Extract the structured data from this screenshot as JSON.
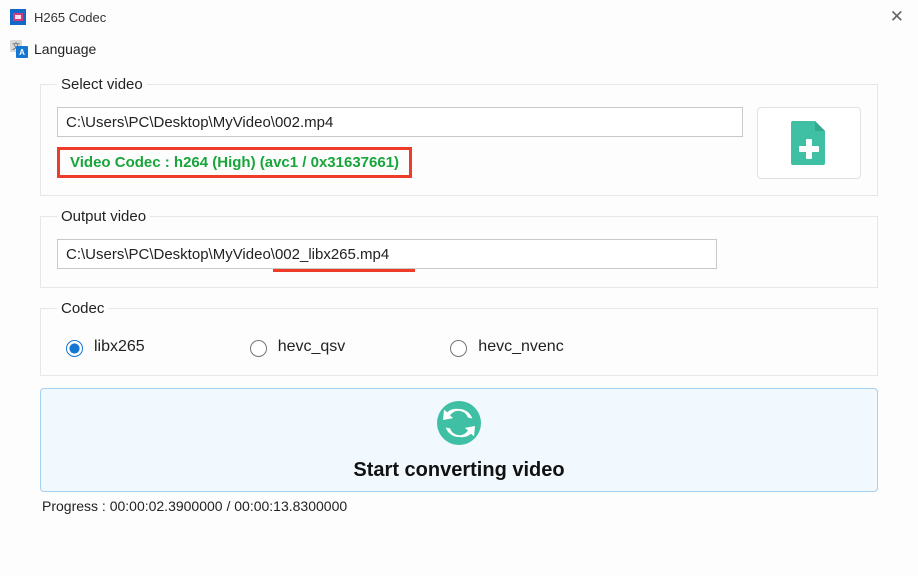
{
  "window": {
    "title": "H265 Codec",
    "close_glyph": "✕"
  },
  "menu": {
    "language_label": "Language"
  },
  "select_video": {
    "legend": "Select video",
    "input_path": "C:\\Users\\PC\\Desktop\\MyVideo\\002.mp4",
    "codec_info": "Video Codec : h264 (High) (avc1 / 0x31637661)"
  },
  "output_video": {
    "legend": "Output video",
    "output_path": "C:\\Users\\PC\\Desktop\\MyVideo\\002_libx265.mp4"
  },
  "codec": {
    "legend": "Codec",
    "selected": "libx265",
    "options": {
      "opt0": "libx265",
      "opt1": "hevc_qsv",
      "opt2": "hevc_nvenc"
    }
  },
  "convert": {
    "label": "Start converting video"
  },
  "progress": {
    "text": "Progress : 00:00:02.3900000 / 00:00:13.8300000"
  },
  "colors": {
    "accent_teal": "#3fbfa4",
    "highlight_red": "#ef3b2a",
    "codec_green": "#18a53a",
    "convert_bg": "#f1f9ff",
    "convert_border": "#a5d1f0"
  }
}
